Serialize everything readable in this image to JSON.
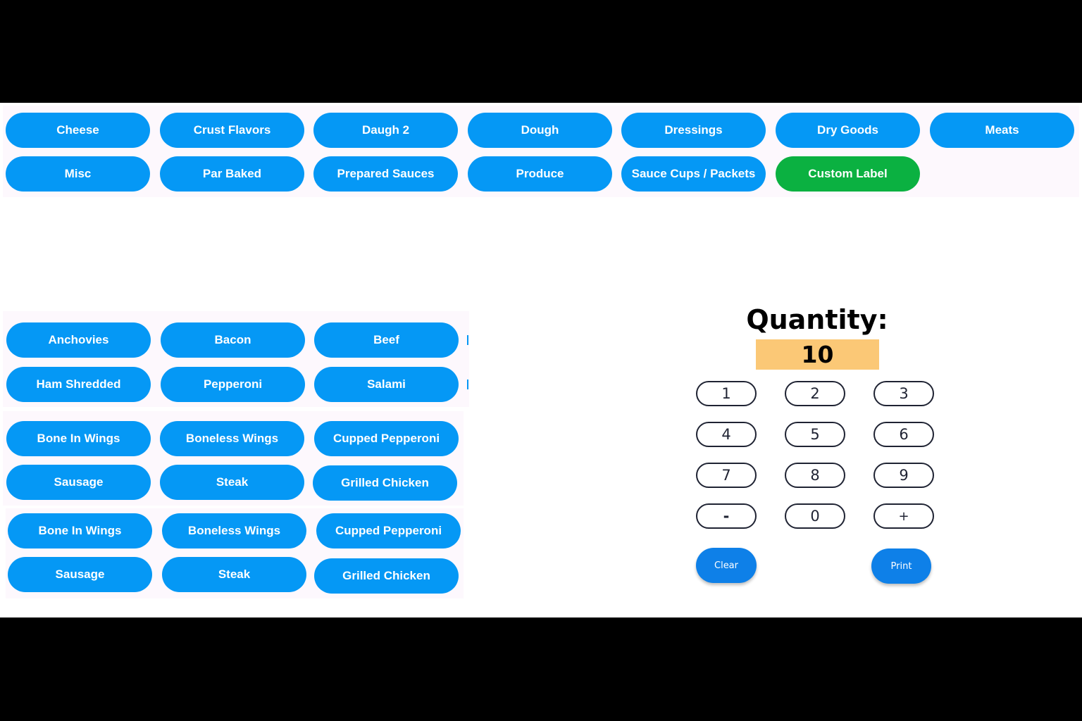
{
  "categories": {
    "row1": [
      "Cheese",
      "Crust Flavors",
      "Daugh 2",
      "Dough",
      "Dressings",
      "Dry Goods",
      "Meats"
    ],
    "row2": [
      "Misc",
      "Par Baked",
      "Prepared Sauces",
      "Produce",
      "Sauce Cups / Packets",
      "Custom Label"
    ]
  },
  "items": {
    "group1": {
      "row1": [
        "Anchovies",
        "Bacon",
        "Beef"
      ],
      "row2": [
        "Ham Shredded",
        "Pepperoni",
        "Salami"
      ]
    },
    "group2": {
      "row1": [
        "Bone In Wings",
        "Boneless Wings",
        "Cupped Pepperoni"
      ],
      "row2": [
        "Sausage",
        "Steak",
        "Grilled Chicken"
      ]
    },
    "group3": {
      "row1": [
        "Bone In Wings",
        "Boneless Wings",
        "Cupped Pepperoni"
      ],
      "row2": [
        "Sausage",
        "Steak",
        "Grilled Chicken"
      ]
    }
  },
  "quantity": {
    "label": "Quantity:",
    "value": "10"
  },
  "keypad": {
    "keys": [
      "1",
      "2",
      "3",
      "4",
      "5",
      "6",
      "7",
      "8",
      "9",
      "-",
      "0",
      "+"
    ],
    "clear_label": "Clear",
    "print_label": "Print"
  },
  "colors": {
    "button_blue": "#0598f5",
    "custom_label_green": "#0bb141",
    "quantity_highlight": "#fbc876",
    "action_blue": "#0e80e8"
  }
}
